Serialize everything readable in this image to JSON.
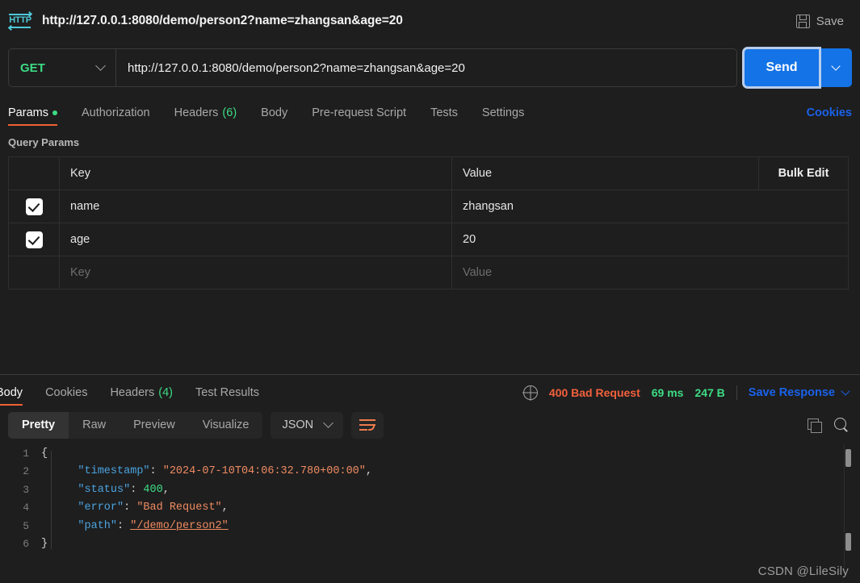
{
  "titlebar": {
    "icon": "http-protocol-icon",
    "title": "http://127.0.0.1:8080/demo/person2?name=zhangsan&age=20",
    "save_label": "Save"
  },
  "request": {
    "method": "GET",
    "url": "http://127.0.0.1:8080/demo/person2?name=zhangsan&age=20",
    "send_label": "Send",
    "tabs": [
      {
        "label": "Params",
        "active": true,
        "dot": true
      },
      {
        "label": "Authorization",
        "active": false
      },
      {
        "label": "Headers",
        "count": "(6)",
        "active": false
      },
      {
        "label": "Body",
        "active": false
      },
      {
        "label": "Pre-request Script",
        "active": false
      },
      {
        "label": "Tests",
        "active": false
      },
      {
        "label": "Settings",
        "active": false
      }
    ],
    "cookies_link": "Cookies",
    "query_params_label": "Query Params",
    "table": {
      "headers": {
        "key": "Key",
        "value": "Value",
        "bulk_edit": "Bulk Edit"
      },
      "rows": [
        {
          "checked": true,
          "key": "name",
          "value": "zhangsan"
        },
        {
          "checked": true,
          "key": "age",
          "value": "20"
        }
      ],
      "placeholder_row": {
        "key": "Key",
        "value": "Value"
      }
    }
  },
  "response": {
    "tabs": [
      {
        "label": "Body",
        "active": true
      },
      {
        "label": "Cookies",
        "active": false
      },
      {
        "label": "Headers",
        "count": "(4)",
        "active": false
      },
      {
        "label": "Test Results",
        "active": false
      }
    ],
    "status": "400 Bad Request",
    "time": "69 ms",
    "size": "247 B",
    "save_response_label": "Save Response",
    "format_tabs": [
      {
        "label": "Pretty",
        "active": true
      },
      {
        "label": "Raw",
        "active": false
      },
      {
        "label": "Preview",
        "active": false
      },
      {
        "label": "Visualize",
        "active": false
      }
    ],
    "language": "JSON",
    "body": {
      "lines": [
        {
          "num": "1",
          "fold": "{",
          "segments": []
        },
        {
          "num": "2",
          "fold": "",
          "key": "\"timestamp\"",
          "sep": ": ",
          "value": "\"2024-07-10T04:06:32.780+00:00\"",
          "vtype": "string",
          "comma": ","
        },
        {
          "num": "3",
          "fold": "",
          "key": "\"status\"",
          "sep": ": ",
          "value": "400",
          "vtype": "number",
          "comma": ","
        },
        {
          "num": "4",
          "fold": "",
          "key": "\"error\"",
          "sep": ": ",
          "value": "\"Bad Request\"",
          "vtype": "string",
          "comma": ","
        },
        {
          "num": "5",
          "fold": "",
          "key": "\"path\"",
          "sep": ": ",
          "value": "\"/demo/person2\"",
          "vtype": "link",
          "comma": ""
        },
        {
          "num": "6",
          "fold": "}",
          "segments": []
        }
      ]
    }
  },
  "watermark": "CSDN @LileSily",
  "colors": {
    "background": "#1e1e1e",
    "accent_orange": "#ef6133",
    "method_green": "#3ddc84",
    "send_blue": "#1473e6",
    "link_blue": "#1a62ea",
    "status_red": "#f2603c",
    "http_icon_cyan": "#4ec9d8"
  }
}
